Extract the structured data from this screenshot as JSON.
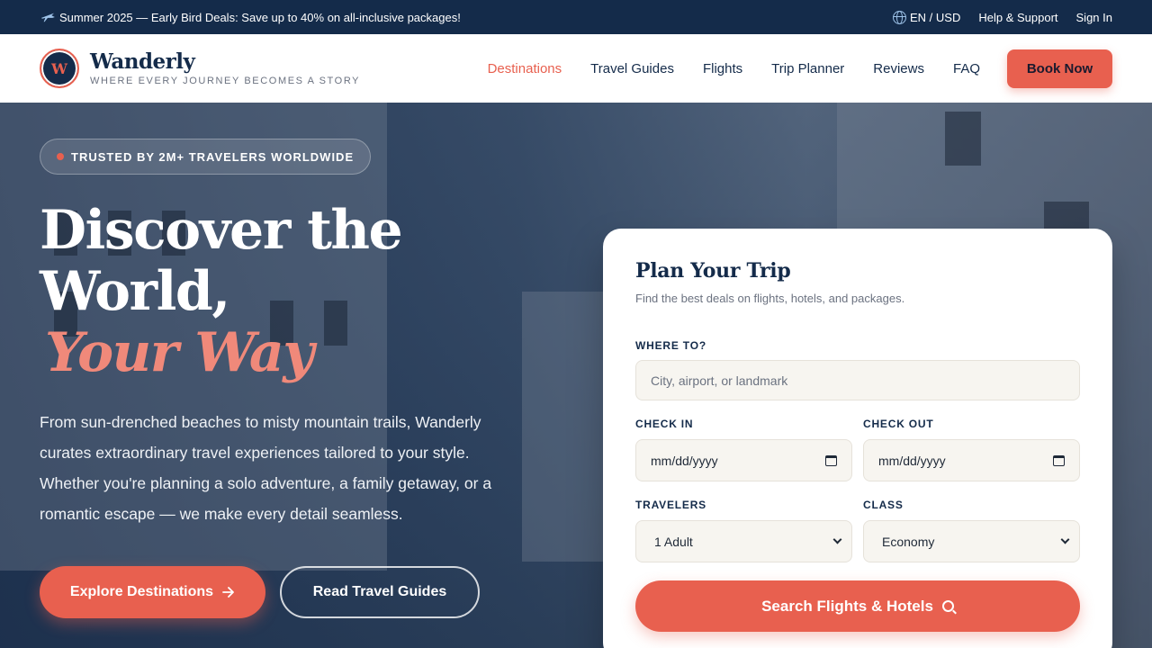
{
  "topbar": {
    "promo_icon": "plane-icon",
    "promo": "Summer 2025 — Early Bird Deals: Save up to 40% on all-inclusive packages!",
    "lang_icon": "globe-icon",
    "lang": "EN / USD",
    "help": "Help & Support",
    "signin": "Sign In"
  },
  "brand": {
    "mark": "W",
    "name": "Wanderly",
    "tagline": "Where every journey becomes a story"
  },
  "nav": {
    "items": [
      {
        "label": "Destinations",
        "active": true
      },
      {
        "label": "Travel Guides"
      },
      {
        "label": "Flights"
      },
      {
        "label": "Trip Planner"
      },
      {
        "label": "Reviews"
      },
      {
        "label": "FAQ"
      }
    ],
    "cta": "Book Now"
  },
  "hero": {
    "badge": "TRUSTED BY 2M+ TRAVELERS WORLDWIDE",
    "headline_line1": "Discover the",
    "headline_line2": "World,",
    "headline_accent": "Your Way",
    "lede": "From sun-drenched beaches to misty mountain trails, Wanderly curates extraordinary travel experiences tailored to your style. Whether you're planning a solo adventure, a family getaway, or a romantic escape — we make every detail seamless.",
    "primary_cta": "Explore Destinations",
    "primary_cta_icon": "arrow-right-icon",
    "secondary_cta": "Read Travel Guides"
  },
  "planner": {
    "title": "Plan Your Trip",
    "subtitle": "Find the best deals on flights, hotels, and packages.",
    "where_label": "WHERE TO?",
    "where_placeholder": "City, airport, or landmark",
    "checkin_label": "CHECK IN",
    "checkin_value": "mm/dd/yyyy",
    "checkout_label": "CHECK OUT",
    "checkout_value": "mm/dd/yyyy",
    "travelers_label": "TRAVELERS",
    "travelers_value": "1 Adult",
    "class_label": "CLASS",
    "class_value": "Economy",
    "search_cta": "Search Flights & Hotels",
    "search_icon": "search-icon"
  },
  "colors": {
    "navy": "#142b4a",
    "coral": "#e8604f",
    "accent_text": "#f0897a"
  }
}
